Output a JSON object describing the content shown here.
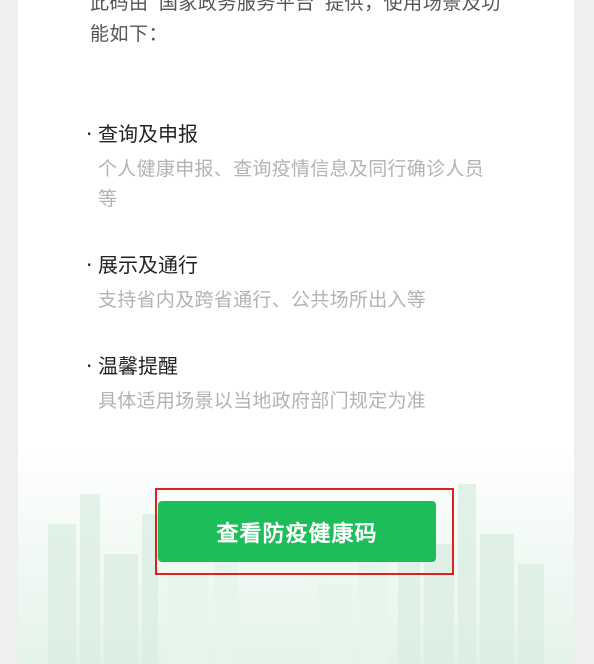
{
  "intro": {
    "text": "此码由“国家政务服务平台”提供，使用场景及功能如下："
  },
  "sections": [
    {
      "title": "查询及申报",
      "desc": "个人健康申报、查询疫情信息及同行确诊人员等"
    },
    {
      "title": "展示及通行",
      "desc": "支持省内及跨省通行、公共场所出入等"
    },
    {
      "title": "温馨提醒",
      "desc": "具体适用场景以当地政府部门规定为准"
    }
  ],
  "bullet": "·",
  "action": {
    "label": "查看防疫健康码"
  },
  "colors": {
    "primary": "#1dbe5a",
    "highlight_border": "#e01f1f",
    "title_text": "#222222",
    "muted_text": "#b3b3b3"
  }
}
